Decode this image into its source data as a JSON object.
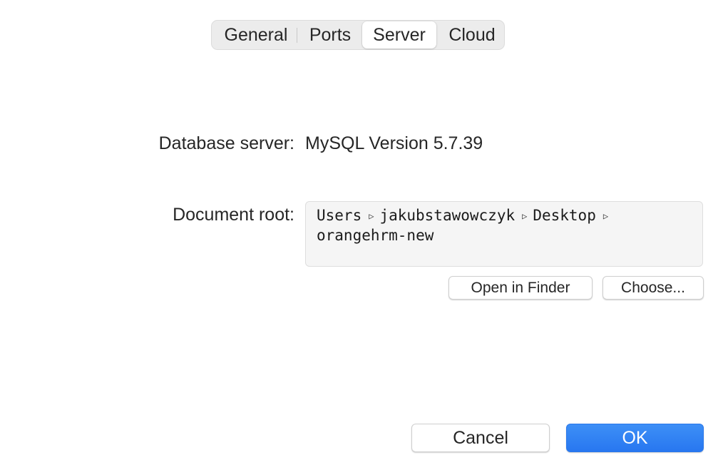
{
  "tabs": [
    {
      "label": "General",
      "selected": false
    },
    {
      "label": "Ports",
      "selected": false
    },
    {
      "label": "Server",
      "selected": true
    },
    {
      "label": "Cloud",
      "selected": false
    }
  ],
  "database": {
    "label": "Database server:",
    "value": "MySQL Version 5.7.39"
  },
  "document_root": {
    "label": "Document root:",
    "path_segments": [
      "Users",
      "jakubstawowczyk",
      "Desktop",
      "orangehrm-new"
    ],
    "separator_icon": "triangle-right-icon",
    "open_in_finder_label": "Open in Finder",
    "choose_label": "Choose..."
  },
  "footer": {
    "cancel_label": "Cancel",
    "ok_label": "OK"
  },
  "colors": {
    "accent": "#2877f0",
    "background": "#ffffff",
    "path_box_background": "#f5f5f5"
  }
}
